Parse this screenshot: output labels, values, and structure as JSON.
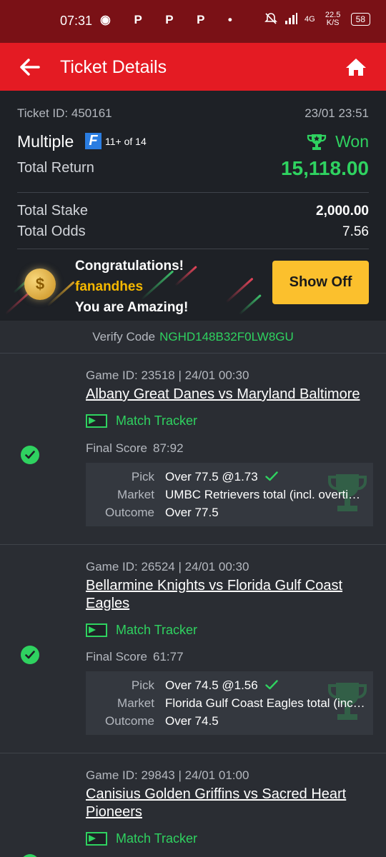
{
  "status_bar": {
    "time": "07:31",
    "notif_icons": "◉ P P P •",
    "network": "4G",
    "speed": "22.5 K/S",
    "battery": "58"
  },
  "header": {
    "title": "Ticket Details"
  },
  "ticket": {
    "id_label": "Ticket ID: 450161",
    "date": "23/01 23:51",
    "type": "Multiple",
    "legs_info": "11+ of 14",
    "status": "Won",
    "total_return_label": "Total Return",
    "total_return": "15,118.00",
    "stake_label": "Total Stake",
    "stake": "2,000.00",
    "odds_label": "Total Odds",
    "odds": "7.56"
  },
  "banner": {
    "line1": "Congratulations!",
    "username": "fanandhes",
    "line3": "You are Amazing!",
    "button": "Show Off"
  },
  "verify": {
    "label": "Verify Code",
    "code": "NGHD148B32F0LW8GU"
  },
  "labels": {
    "tracker": "Match Tracker",
    "final_score": "Final Score",
    "pick": "Pick",
    "market": "Market",
    "outcome": "Outcome"
  },
  "games": [
    {
      "gid": "Game ID: 23518 | 24/01 00:30",
      "match": "Albany Great Danes vs Maryland Baltimore",
      "score": "87:92",
      "pick": "Over 77.5 @1.73",
      "market": "UMBC Retrievers total (incl. overtime)",
      "outcome": "Over 77.5"
    },
    {
      "gid": "Game ID: 26524 | 24/01 00:30",
      "match": "Bellarmine Knights vs Florida Gulf Coast Eagles",
      "score": "61:77",
      "pick": "Over 74.5 @1.56",
      "market": "Florida Gulf Coast Eagles total (incl. overtime)",
      "outcome": "Over 74.5"
    },
    {
      "gid": "Game ID: 29843 | 24/01 01:00",
      "match": "Canisius Golden Griffins vs Sacred Heart Pioneers"
    }
  ],
  "colors": {
    "accent_red": "#e41b23",
    "won_green": "#2fd260",
    "button_yellow": "#fbc02d"
  }
}
